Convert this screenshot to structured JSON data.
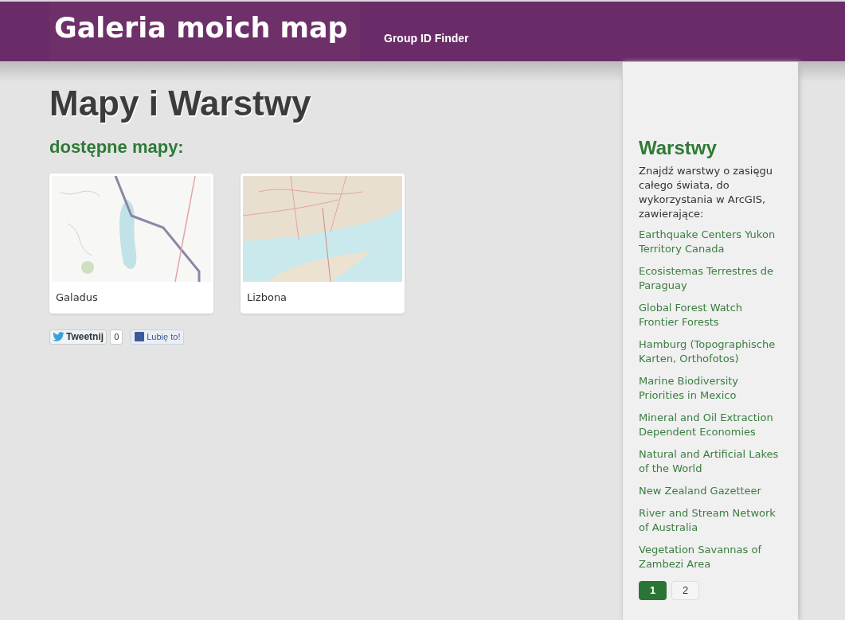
{
  "header": {
    "title": "Galeria moich map",
    "nav": [
      {
        "label": "Group ID Finder"
      }
    ]
  },
  "main": {
    "title": "Mapy i Warstwy",
    "subtitle": "dostępne mapy:",
    "maps": [
      {
        "label": "Galadus",
        "kind": "topo"
      },
      {
        "label": "Lizbona",
        "kind": "city"
      }
    ],
    "social": {
      "tweet": "Tweetnij",
      "tweet_count": "0",
      "like": "Lubię to!"
    }
  },
  "sidebar": {
    "title": "Warstwy",
    "description": "Znajdź warstwy o zasięgu całego świata, do wykorzystania w ArcGIS, zawierające:",
    "links": [
      "Earthquake Centers Yukon Territory Canada",
      "Ecosistemas Terrestres de Paraguay",
      "Global Forest Watch Frontier Forests",
      "Hamburg (Topographische Karten, Orthofotos)",
      "Marine Biodiversity Priorities in Mexico",
      "Mineral and Oil Extraction Dependent Economies",
      "Natural and Artificial Lakes of the World",
      "New Zealand Gazetteer",
      "River and Stream Network of Australia",
      "Vegetation Savannas of Zambezi Area"
    ],
    "pages": [
      {
        "label": "1",
        "selected": true
      },
      {
        "label": "2",
        "selected": false
      }
    ]
  }
}
